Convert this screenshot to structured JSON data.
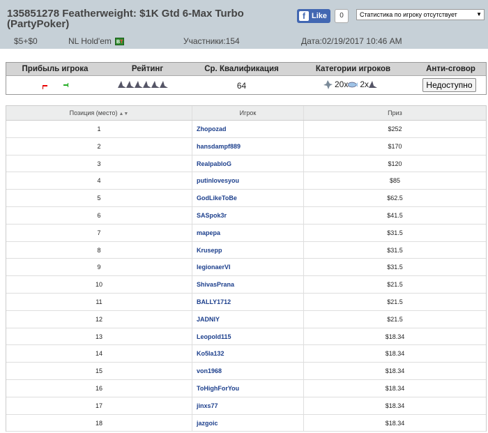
{
  "header": {
    "title": "135851278 Featherweight: $1K Gtd 6-Max Turbo (PartyPoker)",
    "fb_like": "Like",
    "fb_count": "0",
    "stat_select": "Статистика по игроку отсутствует",
    "buyin": "$5+$0",
    "game": "NL Hold'em",
    "participants": "Участники:154",
    "date": "Дата:02/19/2017 10:46 AM"
  },
  "summary": {
    "headers": [
      "Прибыль игрока",
      "Рейтинг",
      "Ср. Квалификация",
      "Категории игроков",
      "Анти-сговор"
    ],
    "avg_qual": "64",
    "cat_a": "20x",
    "cat_b": "2x",
    "anti_button": "Недоступно"
  },
  "results": {
    "columns": [
      "Позиция (место)",
      "Игрок",
      "Приз"
    ],
    "rows": [
      {
        "pos": "1",
        "player": "Zhopozad",
        "prize": "$252"
      },
      {
        "pos": "2",
        "player": "hansdampf889",
        "prize": "$170"
      },
      {
        "pos": "3",
        "player": "RealpabloG",
        "prize": "$120"
      },
      {
        "pos": "4",
        "player": "putinlovesyou",
        "prize": "$85"
      },
      {
        "pos": "5",
        "player": "GodLikeToBe",
        "prize": "$62.5"
      },
      {
        "pos": "6",
        "player": "SASpok3r",
        "prize": "$41.5"
      },
      {
        "pos": "7",
        "player": "mapepa",
        "prize": "$31.5"
      },
      {
        "pos": "8",
        "player": "Krusepp",
        "prize": "$31.5"
      },
      {
        "pos": "9",
        "player": "legionaerVI",
        "prize": "$31.5"
      },
      {
        "pos": "10",
        "player": "ShivasPrana",
        "prize": "$21.5"
      },
      {
        "pos": "11",
        "player": "BALLY1712",
        "prize": "$21.5"
      },
      {
        "pos": "12",
        "player": "JADNIY",
        "prize": "$21.5"
      },
      {
        "pos": "13",
        "player": "Leopold115",
        "prize": "$18.34"
      },
      {
        "pos": "14",
        "player": "Ko5la132",
        "prize": "$18.34"
      },
      {
        "pos": "15",
        "player": "von1968",
        "prize": "$18.34"
      },
      {
        "pos": "16",
        "player": "ToHighForYou",
        "prize": "$18.34"
      },
      {
        "pos": "17",
        "player": "jinxs77",
        "prize": "$18.34"
      },
      {
        "pos": "18",
        "player": "jazgoic",
        "prize": "$18.34"
      }
    ]
  }
}
